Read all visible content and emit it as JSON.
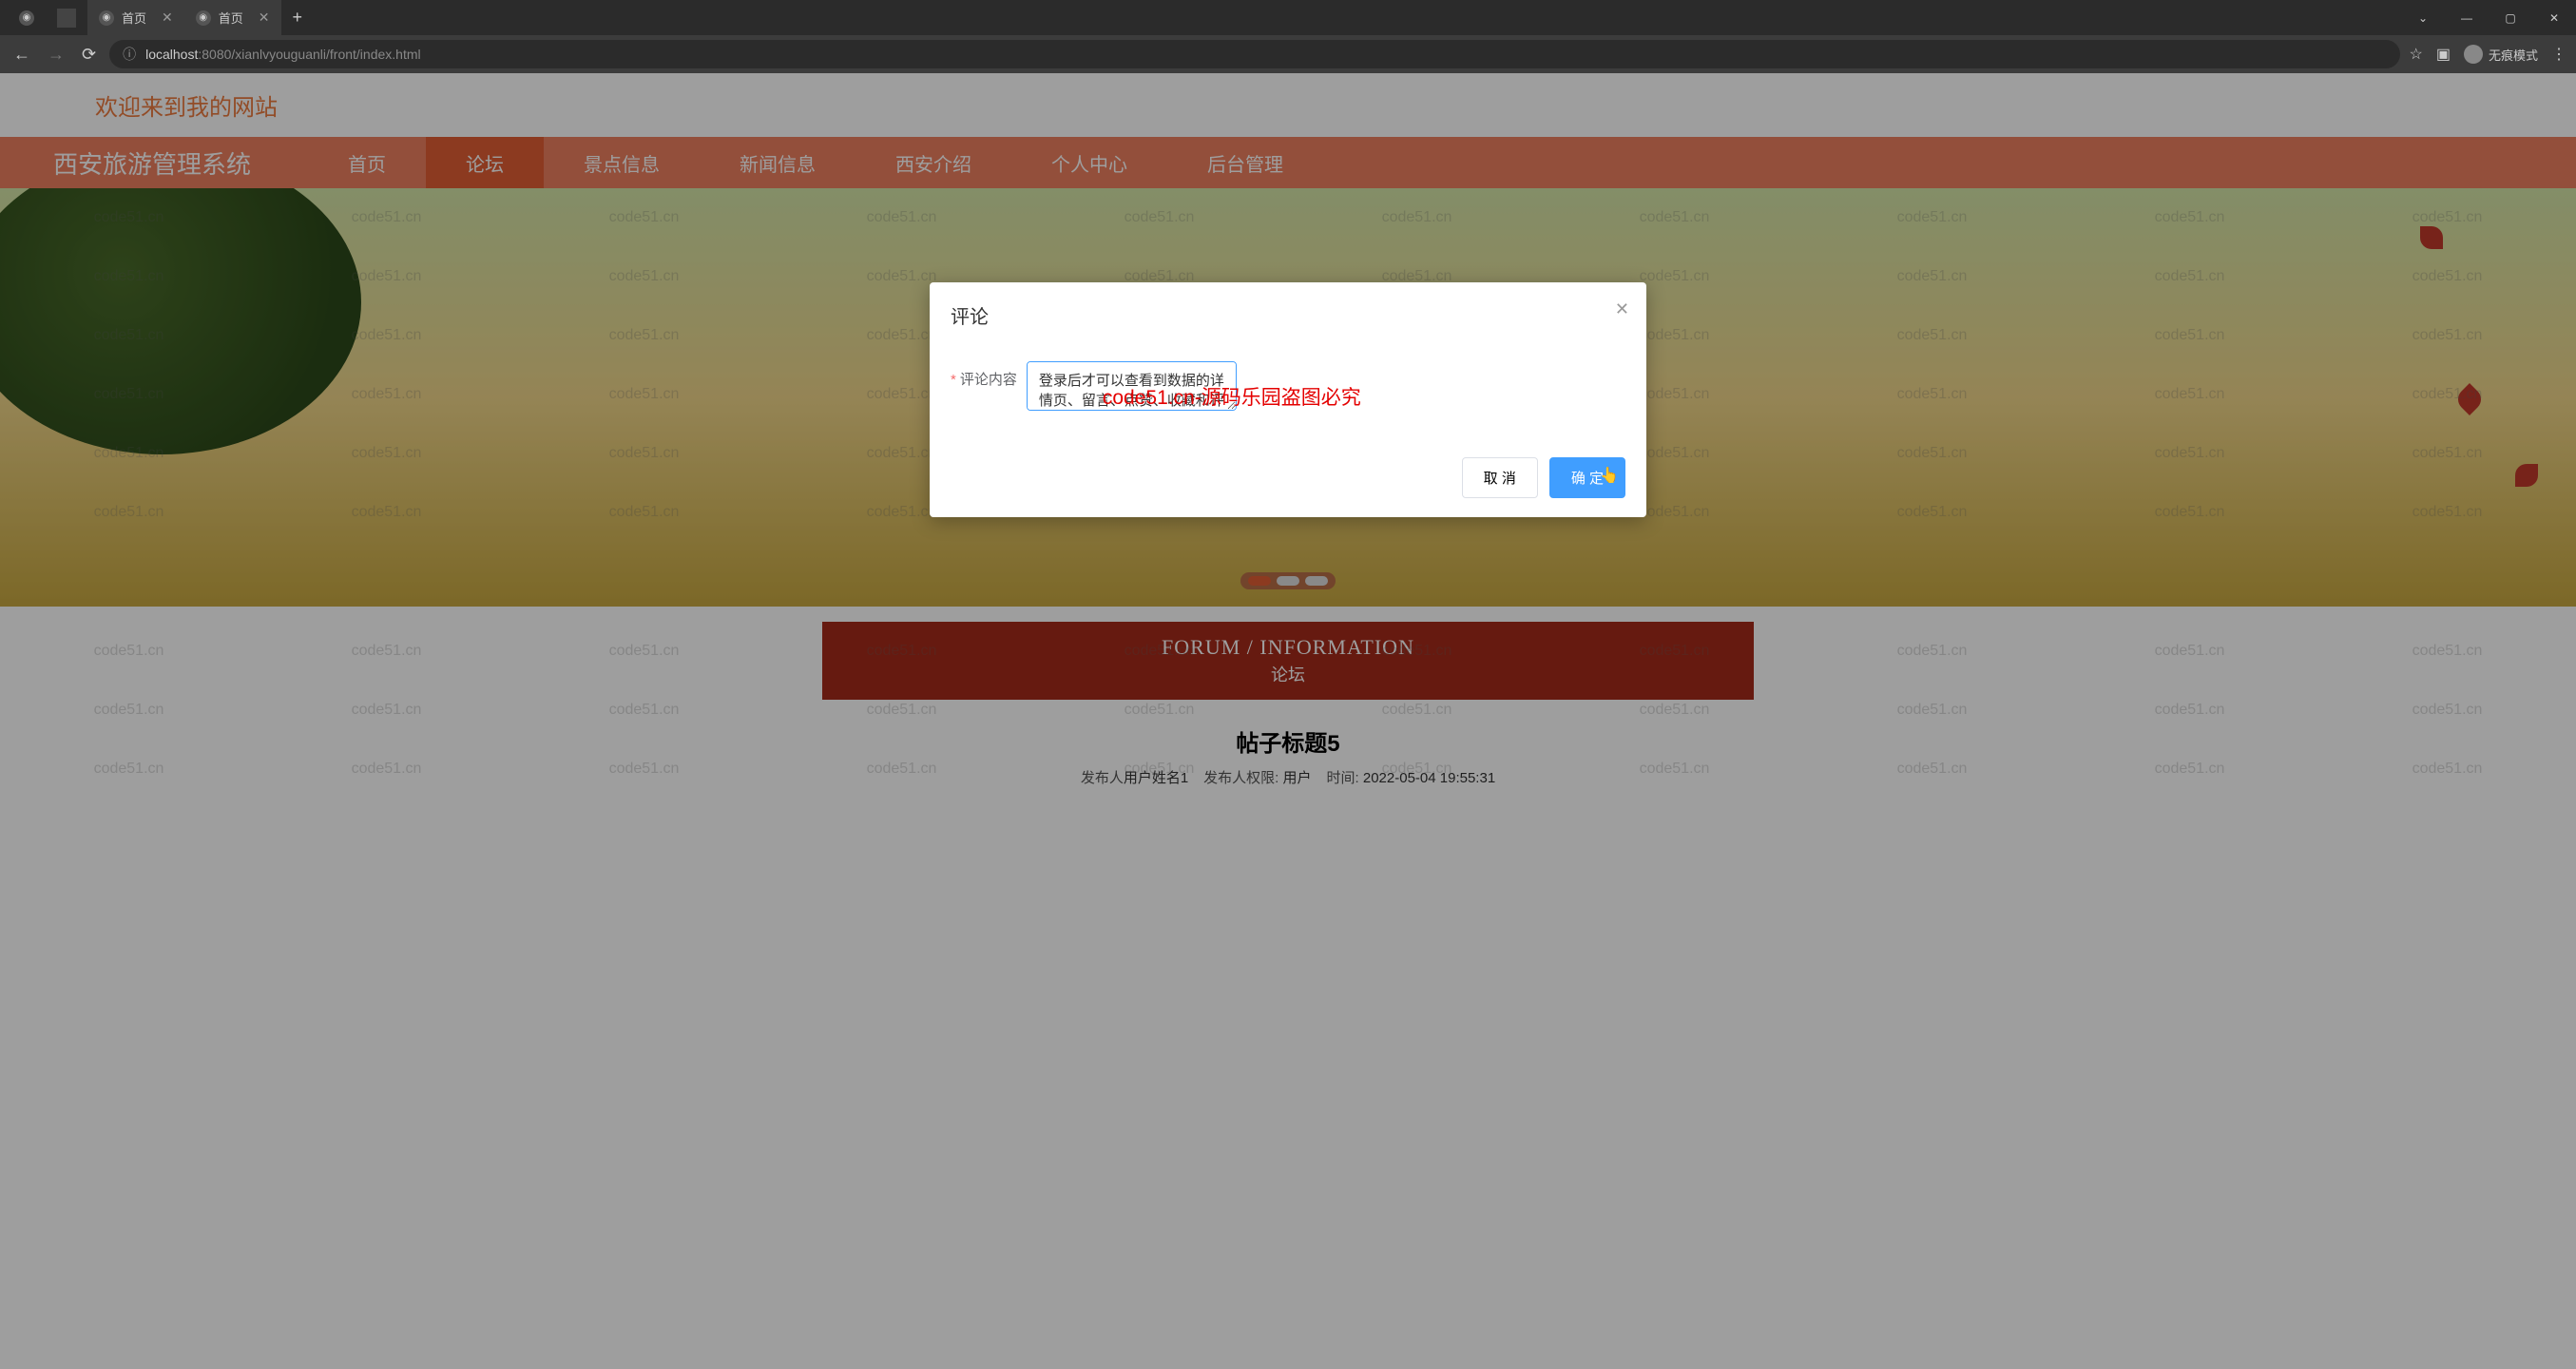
{
  "browser": {
    "tabs": [
      {
        "title": "首页"
      },
      {
        "title": "首页"
      }
    ],
    "url_prefix": "localhost",
    "url_suffix": ":8080/xianlvyouguanli/front/index.html",
    "incognito_label": "无痕模式"
  },
  "page": {
    "welcome": "欢迎来到我的网站",
    "site_title": "西安旅游管理系统",
    "nav": {
      "home": "首页",
      "forum": "论坛",
      "scenery": "景点信息",
      "news": "新闻信息",
      "intro": "西安介绍",
      "personal": "个人中心",
      "admin": "后台管理"
    },
    "watermark": "code51.cn",
    "section": {
      "en": "FORUM / INFORMATION",
      "cn": "论坛"
    },
    "post": {
      "title": "帖子标题5",
      "publisher_label": "发布人",
      "publisher_value": "用户姓名1",
      "role_label": "发布人权限:",
      "role_value": "用户",
      "time_label": "时间:",
      "time_value": "2022-05-04 19:55:31"
    }
  },
  "dialog": {
    "title": "评论",
    "field_label": "评论内容",
    "textarea_value": "登录后才可以查看到数据的详情页、留言、点赞、收藏和评论",
    "watermark_text": "code51.cn-源码乐园盗图必究",
    "cancel_label": "取 消",
    "confirm_label": "确 定"
  }
}
